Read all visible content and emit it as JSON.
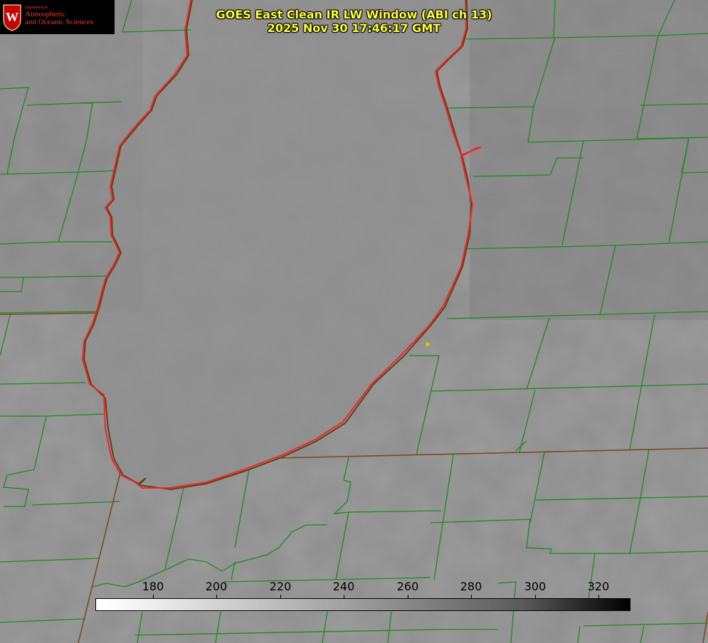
{
  "title": {
    "line1": "GOES East Clean IR LW Window (ABI ch 13)",
    "line2": "2025 Nov 30 17:46:17 GMT"
  },
  "logo": {
    "department": "Department of",
    "name_line1": "Atmospheric",
    "name_line2": "and Oceanic Sciences"
  },
  "colorbar": {
    "ticks": [
      "180",
      "200",
      "220",
      "240",
      "260",
      "280",
      "300",
      "320"
    ],
    "range": [
      170,
      330
    ]
  },
  "colors": {
    "title": "#ffff33",
    "county_lines": "#1a8c1a",
    "state_lines": "#8b3a1a",
    "lake_outline": "#ff2020",
    "station_marker": "#d4c400"
  },
  "map": {
    "feature": "Lake Michigan",
    "station_marker": "yellow dot"
  }
}
